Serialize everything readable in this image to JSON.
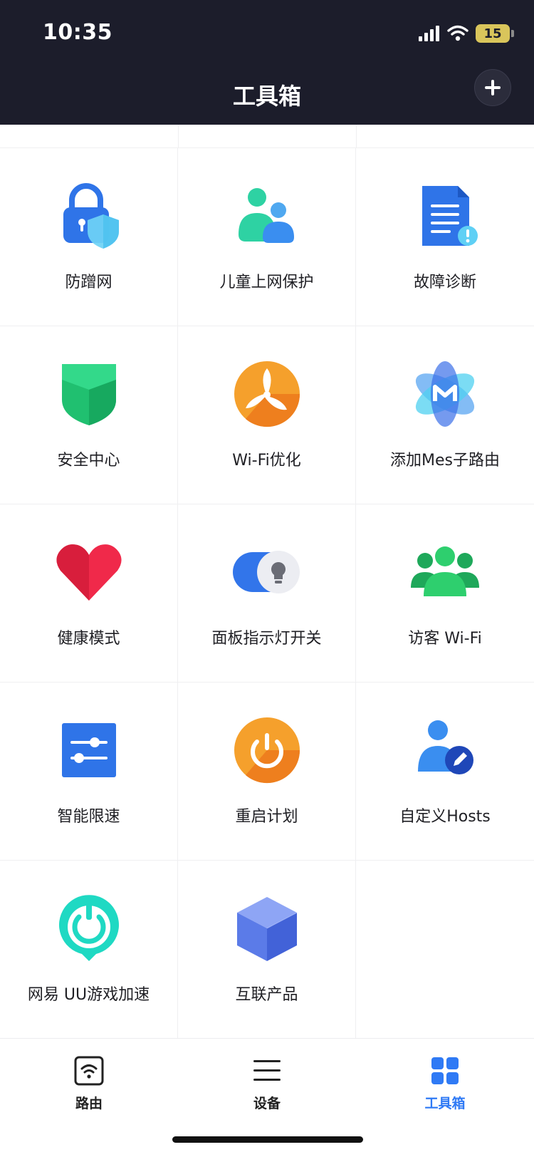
{
  "status_bar": {
    "time": "10:35",
    "battery": "15"
  },
  "header": {
    "title": "工具箱",
    "add_icon": "plus-icon"
  },
  "tools": [
    {
      "label": "防蹭网",
      "icon": "lock-shield-icon"
    },
    {
      "label": "儿童上网保护",
      "icon": "parent-child-icon"
    },
    {
      "label": "故障诊断",
      "icon": "document-alert-icon"
    },
    {
      "label": "安全中心",
      "icon": "green-shield-icon"
    },
    {
      "label": "Wi-Fi优化",
      "icon": "fan-icon"
    },
    {
      "label": "添加Mes子路由",
      "icon": "mesh-atom-icon"
    },
    {
      "label": "健康模式",
      "icon": "heart-icon"
    },
    {
      "label": "面板指示灯开关",
      "icon": "light-toggle-icon"
    },
    {
      "label": "访客 Wi-Fi",
      "icon": "guest-group-icon"
    },
    {
      "label": "智能限速",
      "icon": "slider-settings-icon"
    },
    {
      "label": "重启计划",
      "icon": "power-icon"
    },
    {
      "label": "自定义Hosts",
      "icon": "user-edit-icon"
    },
    {
      "label": "网易 UU游戏加速",
      "icon": "uu-accelerator-icon"
    },
    {
      "label": "互联产品",
      "icon": "cube-icon"
    }
  ],
  "tabbar": {
    "items": [
      {
        "label": "路由",
        "icon": "router-wifi-icon",
        "active": false
      },
      {
        "label": "设备",
        "icon": "menu-lines-icon",
        "active": false
      },
      {
        "label": "工具箱",
        "icon": "grid-icon",
        "active": true
      }
    ]
  },
  "colors": {
    "header_bg": "#1c1d2b",
    "accent": "#2f7af5",
    "battery": "#d9c55b"
  }
}
